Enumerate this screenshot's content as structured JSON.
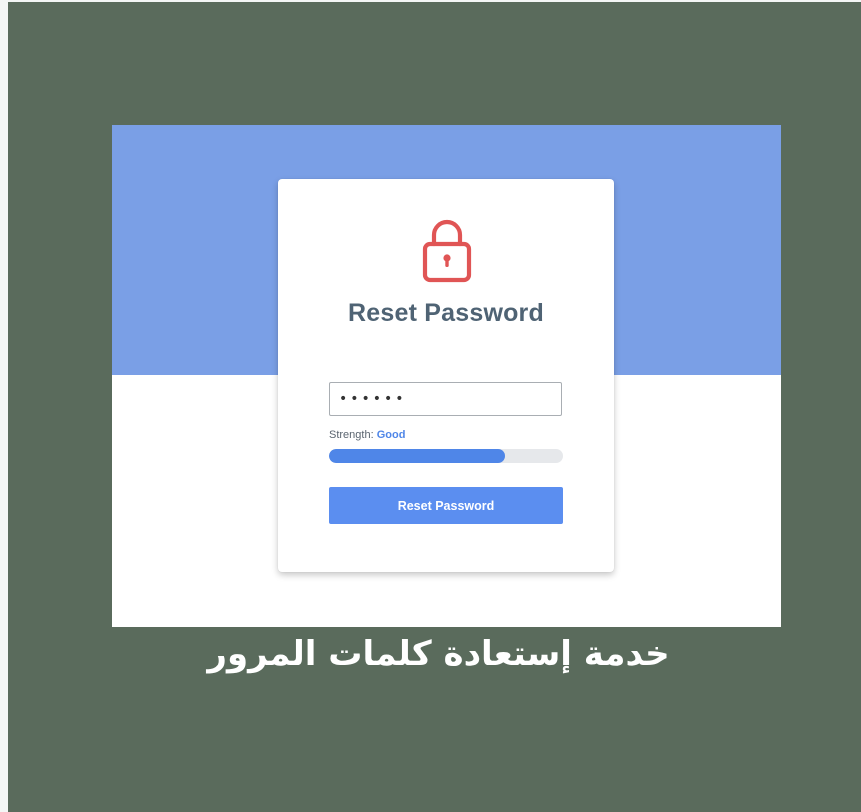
{
  "card": {
    "title": "Reset Password",
    "icon": "lock-icon",
    "icon_color": "#e05555"
  },
  "password": {
    "value": "••••••",
    "type": "password"
  },
  "strength": {
    "label": "Strength:",
    "value": "Good",
    "level_percent": 75,
    "color": "#4f86e8"
  },
  "button": {
    "label": "Reset Password",
    "color": "#5b8ef0"
  },
  "caption": {
    "text": "خدمة إستعادة كلمات المرور"
  },
  "colors": {
    "background": "#5a6b5c",
    "header_band": "#7a9fe6",
    "title": "#4f6374"
  }
}
